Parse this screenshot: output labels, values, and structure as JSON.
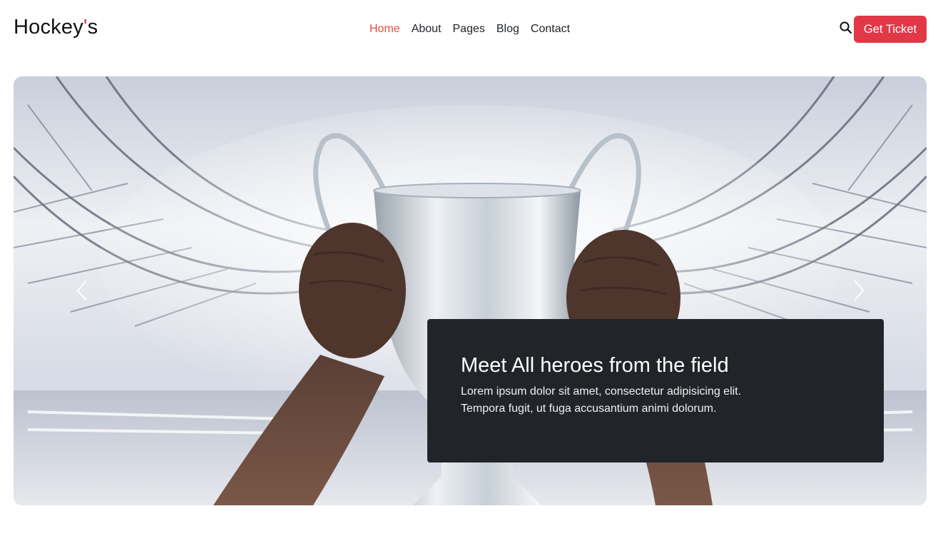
{
  "logo": {
    "main": "Hockey",
    "accent": "'",
    "suffix": "s"
  },
  "nav": {
    "items": [
      {
        "label": "Home",
        "active": true
      },
      {
        "label": "About"
      },
      {
        "label": "Pages"
      },
      {
        "label": "Blog"
      },
      {
        "label": "Contact"
      }
    ]
  },
  "header": {
    "search_icon": "search-icon",
    "ticket_label": "Get Ticket"
  },
  "hero": {
    "prev_icon": "chevron-left-icon",
    "next_icon": "chevron-right-icon",
    "caption_title": "Meet All heroes from the field",
    "caption_text": "Lorem ipsum dolor sit amet, consectetur adipisicing elit. Tempora fugit, ut fuga accusantium animi dolorum."
  },
  "colors": {
    "accent": "#e23747",
    "nav_active": "#e0503c",
    "caption_bg": "#212429"
  }
}
